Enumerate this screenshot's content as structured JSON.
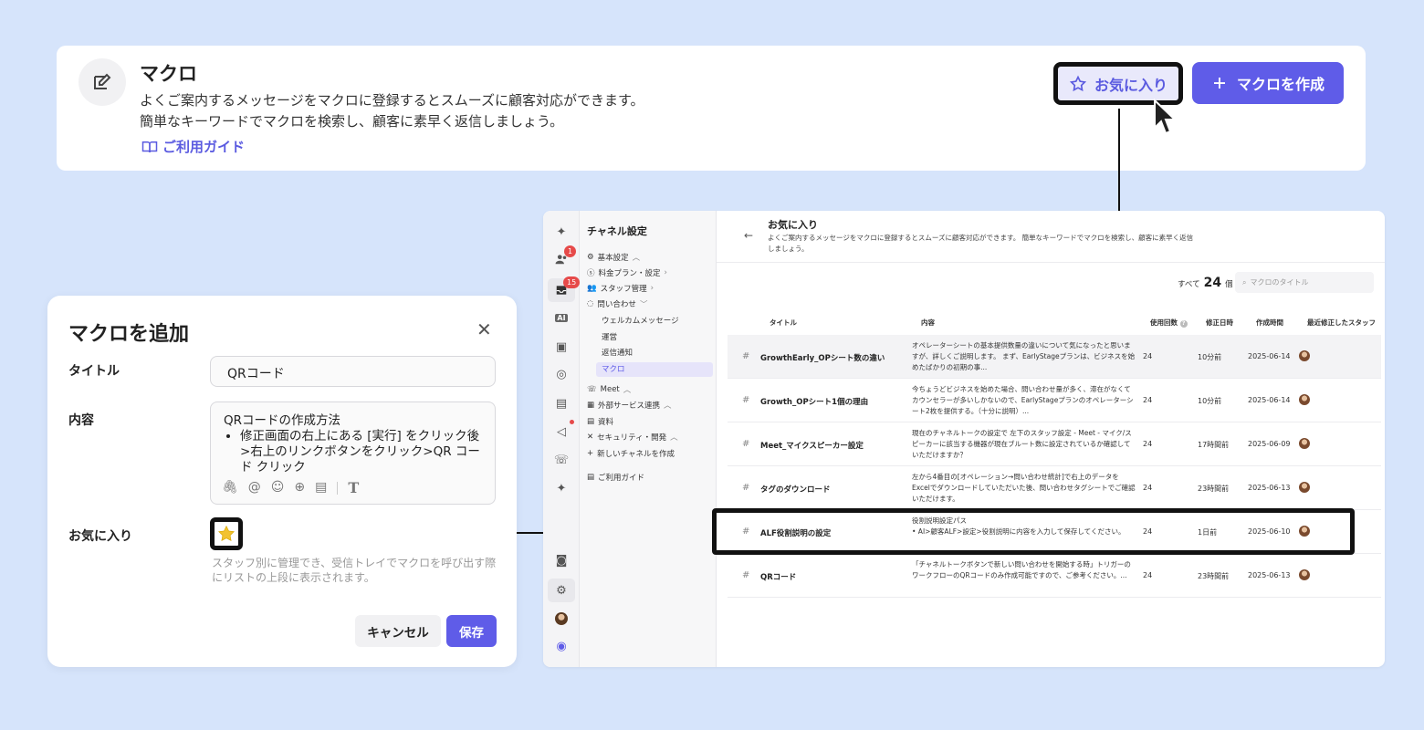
{
  "header": {
    "title": "マクロ",
    "desc_line1": "よくご案内するメッセージをマクロに登録するとスムーズに顧客対応ができます。",
    "desc_line2": "簡単なキーワードでマクロを検索し、顧客に素早く返信しましょう。",
    "guide_link": "ご利用ガイド",
    "favorites_button": "お気に入り",
    "create_button": "マクロを作成",
    "accent_color": "#5f5ce8"
  },
  "app": {
    "rail_badges": {
      "team": "1",
      "inbox": "15"
    },
    "rail_ai": "AI",
    "sidebar": {
      "title": "チャネル設定",
      "items": [
        {
          "label": "基本設定",
          "icon": "gear-icon"
        },
        {
          "label": "料金プラン・設定",
          "icon": "coin-icon"
        },
        {
          "label": "スタッフ管理",
          "icon": "users-icon"
        },
        {
          "label": "問い合わせ",
          "icon": "chat-icon"
        }
      ],
      "sub_items": [
        "ウェルカムメッセージ",
        "運営",
        "返信通知",
        "マクロ"
      ],
      "items2": [
        {
          "label": "Meet",
          "icon": "phone-icon"
        },
        {
          "label": "外部サービス連携",
          "icon": "grid-icon"
        },
        {
          "label": "資料",
          "icon": "book-icon"
        },
        {
          "label": "セキュリティ・開発",
          "icon": "tools-icon"
        },
        {
          "label": "新しいチャネルを作成",
          "icon": "plus-icon"
        },
        {
          "label": "ご利用ガイド",
          "icon": "book-icon"
        }
      ]
    },
    "main": {
      "title": "お気に入り",
      "desc": "よくご案内するメッセージをマクロに登録するとスムーズに顧客対応ができます。 簡単なキーワードでマクロを検索し、顧客に素早く返信しましょう。",
      "count_label": "すべて",
      "count_value": "24",
      "count_unit": "個",
      "search_placeholder": "マクロのタイトル",
      "columns": {
        "title": "タイトル",
        "content": "内容",
        "usage": "使用回数",
        "updated": "修正日時",
        "created": "作成時間",
        "staff": "最近修正したスタッフ"
      },
      "rows": [
        {
          "title": "GrowthEarly_OPシート数の違い",
          "content": "オペレーターシートの基本提供数量の違いについて気になったと思いますが、詳しくご説明します。 まず、EarlyStageプランは、ビジネスを始めたばかりの初期の事...",
          "usage": "24",
          "updated": "10分前",
          "created": "2025-06-14"
        },
        {
          "title": "Growth_OPシート1個の理由",
          "content": "今ちょうどビジネスを始めた場合、問い合わせ量が多く、滞在がなくてカウンセラーが多いしかないので、EarlyStageプランのオペレーターシート2枚を提供する。（十分に説明）...",
          "usage": "24",
          "updated": "10分前",
          "created": "2025-06-14"
        },
        {
          "title": "Meet_マイクスピーカー設定",
          "content": "現在のチャネルトークの設定で 左下のスタッフ設定 - Meet - マイク/スピーカーに該当する機器が現在ブルート数に設定されているか確認していただけますか？",
          "usage": "24",
          "updated": "17時間前",
          "created": "2025-06-09"
        },
        {
          "title": "タグのダウンロード",
          "content": "左から4番目の[オペレーション→問い合わせ統計]で右上のデータをExcelでダウンロードしていただいた後、問い合わせタグシートでご確認いただけます。",
          "usage": "24",
          "updated": "23時間前",
          "created": "2025-06-13"
        },
        {
          "title": "ALF役割説明の設定",
          "content": "役割説明設定パス\n• AI>顧客ALF>設定>役割説明に内容を入力して保存してください。",
          "usage": "24",
          "updated": "1日前",
          "created": "2025-06-10"
        },
        {
          "title": "QRコード",
          "content": "「チャネルトークボタンで新しい問い合わせを開始する時」トリガーのワークフローのQRコードのみ作成可能ですので、ご参考ください。...",
          "usage": "24",
          "updated": "23時間前",
          "created": "2025-06-13"
        }
      ]
    }
  },
  "dialog": {
    "title": "マクロを追加",
    "title_label": "タイトル",
    "title_value": "QRコード",
    "content_label": "内容",
    "content_line1": "QRコードの作成方法",
    "content_bullet": "修正画面の右上にある [実行] をクリック後 >右上のリンクボタンをクリック>QR コード クリック",
    "favorite_label": "お気に入り",
    "favorite_note": "スタッフ別に管理でき、受信トレイでマクロを呼び出す際にリストの上段に表示されます。",
    "cancel_button": "キャンセル",
    "save_button": "保存",
    "star_color": "#f2c230"
  }
}
